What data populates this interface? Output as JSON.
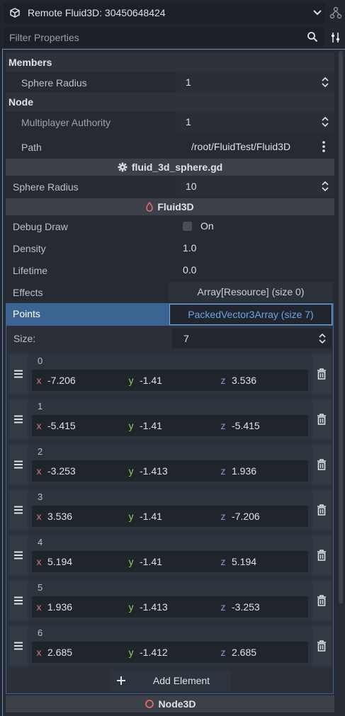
{
  "header": {
    "object_title": "Remote Fluid3D: 30450648424",
    "filter_placeholder": "Filter Properties"
  },
  "sections": {
    "members": "Members",
    "node": "Node"
  },
  "properties": {
    "sphere_radius_member": {
      "label": "Sphere Radius",
      "value": "1"
    },
    "multiplayer_authority": {
      "label": "Multiplayer Authority",
      "value": "1"
    },
    "path": {
      "label": "Path",
      "value": "/root/FluidTest/Fluid3D"
    },
    "script_category": "fluid_3d_sphere.gd",
    "sphere_radius_script": {
      "label": "Sphere Radius",
      "value": "10"
    },
    "fluid_category": "Fluid3D",
    "debug_draw": {
      "label": "Debug Draw",
      "value": "On",
      "checked": false
    },
    "density": {
      "label": "Density",
      "value": "1.0"
    },
    "lifetime": {
      "label": "Lifetime",
      "value": "0.0"
    },
    "effects": {
      "label": "Effects",
      "value": "Array[Resource] (size 0)"
    },
    "points": {
      "label": "Points",
      "value": "PackedVector3Array (size 7)"
    },
    "size": {
      "label": "Size:",
      "value": "7"
    },
    "node3d_category": "Node3D"
  },
  "axis_labels": {
    "x": "x",
    "y": "y",
    "z": "z"
  },
  "points_elements": [
    {
      "index": "0",
      "x": "-7.206",
      "y": "-1.41",
      "z": "3.536"
    },
    {
      "index": "1",
      "x": "-5.415",
      "y": "-1.41",
      "z": "-5.415"
    },
    {
      "index": "2",
      "x": "-3.253",
      "y": "-1.413",
      "z": "1.936"
    },
    {
      "index": "3",
      "x": "3.536",
      "y": "-1.41",
      "z": "-7.206"
    },
    {
      "index": "4",
      "x": "5.194",
      "y": "-1.41",
      "z": "5.194"
    },
    {
      "index": "5",
      "x": "1.936",
      "y": "-1.413",
      "z": "-3.253"
    },
    {
      "index": "6",
      "x": "2.685",
      "y": "-1.412",
      "z": "2.685"
    }
  ],
  "add_element_label": "Add Element",
  "colors": {
    "axis_x": "#d17a7a",
    "axis_y": "#8fca6a",
    "axis_z": "#7a9fe0",
    "accent": "#6ba4eb",
    "fluid_icon": "#e66a6a"
  },
  "icons": {
    "object": "cube-icon",
    "dropdown": "chevron-down-icon",
    "history": "node-tree-icon",
    "search": "search-icon",
    "filter_options": "filter-options-icon",
    "spin": "spin-arrows-icon",
    "menu": "kebab-menu-icon",
    "script": "gear-icon",
    "fluid": "droplet-icon",
    "drag": "drag-handle-icon",
    "remove": "trash-icon",
    "add": "plus-icon",
    "node3d": "node3d-circle-icon"
  }
}
